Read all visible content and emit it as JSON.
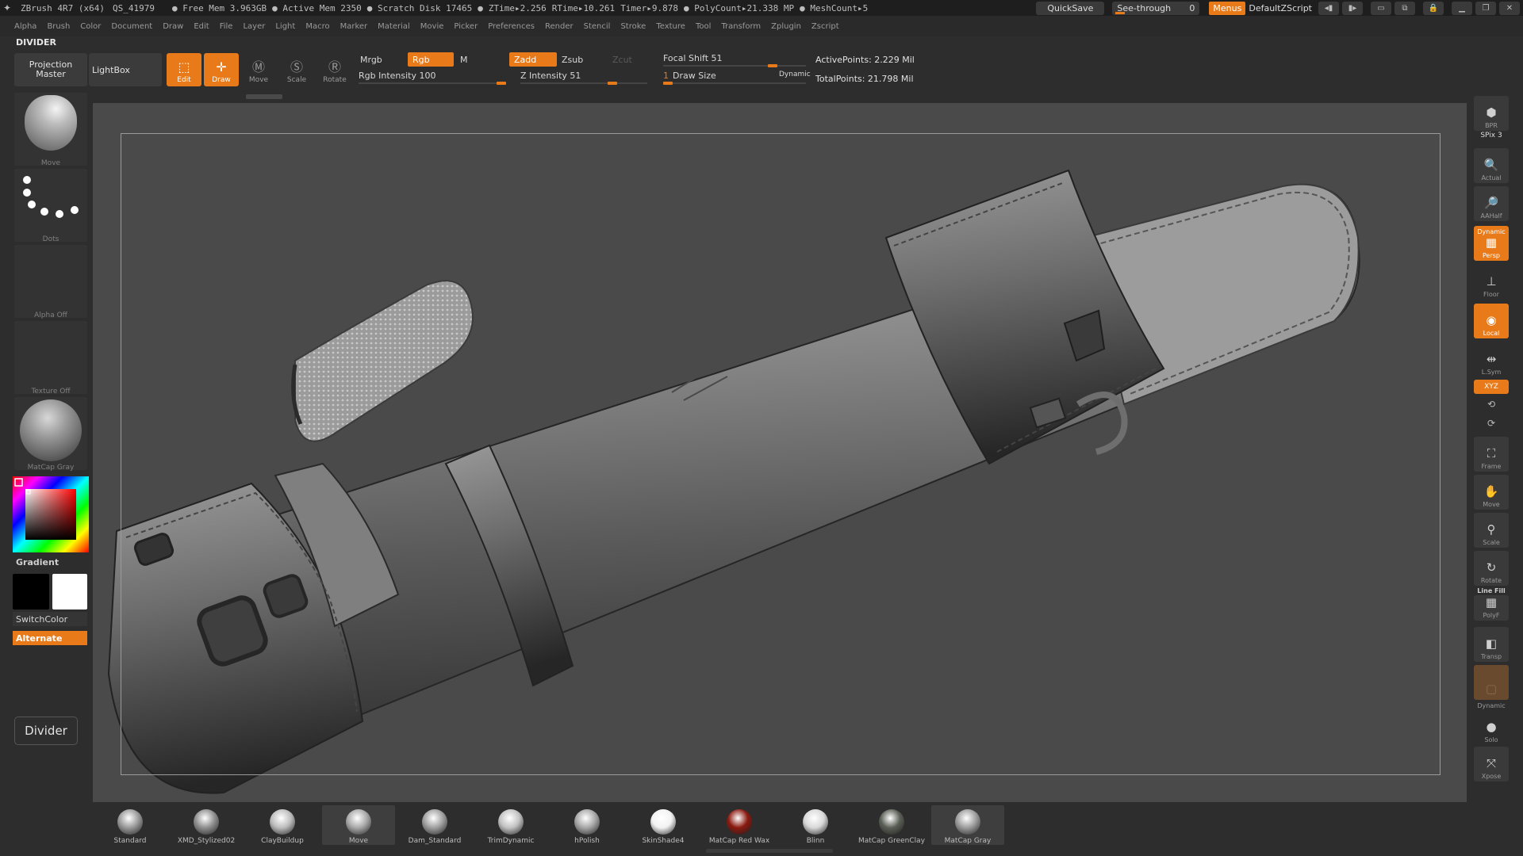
{
  "titlebar": {
    "app": "ZBrush 4R7 (x64)",
    "session": "QS_41979",
    "stats": [
      "● Free Mem 3.963GB",
      "● Active Mem 2350",
      "● Scratch Disk 17465",
      "●",
      "ZTime▸2.256",
      "RTime▸10.261",
      "Timer▸9.878",
      "● PolyCount▸21.338 MP",
      "● MeshCount▸5"
    ],
    "quicksave": "QuickSave",
    "seethrough": "See-through",
    "seethrough_value": "0",
    "menus": "Menus",
    "script": "DefaultZScript"
  },
  "menubar": [
    "Alpha",
    "Brush",
    "Color",
    "Document",
    "Draw",
    "Edit",
    "File",
    "Layer",
    "Light",
    "Macro",
    "Marker",
    "Material",
    "Movie",
    "Picker",
    "Preferences",
    "Render",
    "Stencil",
    "Stroke",
    "Texture",
    "Tool",
    "Transform",
    "Zplugin",
    "Zscript"
  ],
  "divider_label": "DIVIDER",
  "shelf": {
    "projection_master": "Projection Master",
    "lightbox": "LightBox",
    "edit": "Edit",
    "draw": "Draw",
    "move": "Move",
    "scale": "Scale",
    "rotate": "Rotate",
    "mrgb": "Mrgb",
    "rgb": "Rgb",
    "m": "M",
    "zadd": "Zadd",
    "zsub": "Zsub",
    "zcut": "Zcut",
    "rgb_intensity": "Rgb Intensity 100",
    "z_intensity": "Z Intensity 51",
    "focal_shift": "Focal Shift 51",
    "draw_size": "Draw Size",
    "draw_size_value": "1",
    "dynamic": "Dynamic",
    "active_points": "ActivePoints: 2.229 Mil",
    "total_points": "TotalPoints: 21.798 Mil",
    "rgb_intensity_level": 1.0,
    "z_intensity_level": 0.51,
    "focal_shift_level": 0.51
  },
  "lefttray": {
    "brush": "Move",
    "stroke": "Dots",
    "alpha": "Alpha Off",
    "texture": "Texture Off",
    "material": "MatCap Gray",
    "gradient": "Gradient",
    "switchcolor": "SwitchColor",
    "alternate": "Alternate",
    "divider_button": "Divider"
  },
  "righttray": {
    "bpr": "BPR",
    "spix": "SPix 3",
    "actual": "Actual",
    "aahalf": "AAHalf",
    "dynamic_top": "Dynamic",
    "persp": "Persp",
    "floor": "Floor",
    "local": "Local",
    "lsym": "L.Sym",
    "xyz": "XYZ",
    "frame": "Frame",
    "move": "Move",
    "scale": "Scale",
    "rotate": "Rotate",
    "linefill": "Line Fill",
    "polyf": "PolyF",
    "transp": "Transp",
    "dynamic_bottom": "Dynamic",
    "solo": "Solo",
    "xpose": "Xpose"
  },
  "materials": [
    {
      "label": "Standard",
      "color": "#9a9a9a"
    },
    {
      "label": "XMD_Stylized02",
      "color": "#8f8f8f"
    },
    {
      "label": "ClayBuildup",
      "color": "#bdbdbd"
    },
    {
      "label": "Move",
      "color": "#a9a9a9"
    },
    {
      "label": "Dam_Standard",
      "color": "#a0a0a0"
    },
    {
      "label": "TrimDynamic",
      "color": "#c2c2c2"
    },
    {
      "label": "hPolish",
      "color": "#a7a7a7"
    },
    {
      "label": "SkinShade4",
      "color": "#f2f2f2"
    },
    {
      "label": "MatCap Red Wax",
      "color": "#8a1a10"
    },
    {
      "label": "Blinn",
      "color": "#d8d8d8"
    },
    {
      "label": "MatCap GreenClay",
      "color": "#5a5f55"
    },
    {
      "label": "MatCap Gray",
      "color": "#9d9d9d"
    }
  ],
  "colors": {
    "accent": "#e87a1a",
    "canvas": "#4a4a4a",
    "panel": "#2d2d2d"
  }
}
